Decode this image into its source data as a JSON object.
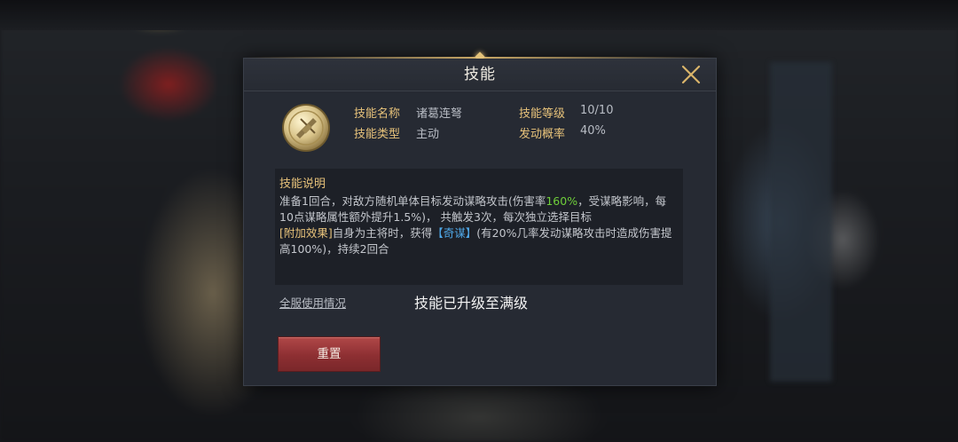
{
  "dialog": {
    "title": "技能",
    "close_icon": "close-icon"
  },
  "skill": {
    "icon": "skill-crossbow-medallion-icon",
    "name_label": "技能名称",
    "name_value": "诸葛连弩",
    "level_label": "技能等级",
    "level_value": "10/10",
    "type_label": "技能类型",
    "type_value": "主动",
    "trigger_label": "发动概率",
    "trigger_value": "40%"
  },
  "description": {
    "heading": "技能说明",
    "line1_before": "准备1回合，对敌方随机单体目标发动谋略攻击(伤害率",
    "damage_rate": "160%",
    "line1_after": "，受谋略影响，每10点谋略属性额外提升1.5%)， 共触发3次，每次独立选择目标",
    "extra_tag": "[附加效果]",
    "extra_before": "自身为主将时，获得",
    "extra_buff": "【奇谋】",
    "extra_after": "(有20%几率发动谋略攻击时造成伤害提高100%)，持续2回合"
  },
  "footer": {
    "server_usage_link": "全服使用情况",
    "maxed_message": "技能已升级至满级",
    "reset_button": "重置"
  },
  "colors": {
    "accent_gold": "#e7c27a",
    "highlight_green": "#6fcf3a",
    "highlight_blue": "#4fa8e8",
    "button_red": "#8d2f32"
  }
}
